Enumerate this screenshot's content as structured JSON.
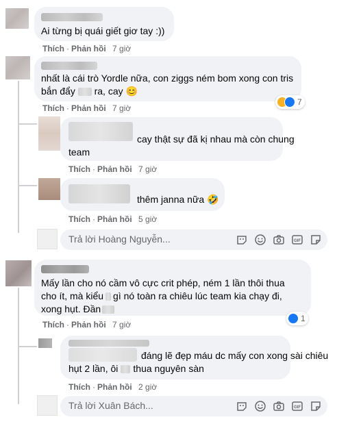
{
  "comments": [
    {
      "text": "Ai từng bị quái giết giơ tay :))",
      "like": "Thích",
      "reply": "Phản hồi",
      "time": "7 giờ"
    },
    {
      "text_line1": "nhất là cái trò Yordle nữa, con ziggs ném bom xong con tris",
      "text_line2_a": "bắn đẩy",
      "text_line2_b": "ra, cay 😊",
      "like": "Thích",
      "reply": "Phản hồi",
      "time": "7 giờ",
      "reaction_count": "7"
    },
    {
      "text_a": "cay thật sự đã kị nhau mà còn chung",
      "text_b": "team",
      "like": "Thích",
      "reply": "Phản hồi",
      "time": "7 giờ"
    },
    {
      "text": "thêm janna nữa 🤣",
      "like": "Thích",
      "reply": "Phản hồi",
      "time": "5 giờ"
    },
    {
      "placeholder": "Trả lời Hoàng Nguyễn..."
    },
    {
      "text_line1": "Mấy lần cho nó cầm vô cực crit phép, ném 1 lần thôi thua",
      "text_line2_a": "cho ít, mà kiểu",
      "text_line2_b": "gì nó toàn ra chiêu lúc team kia chạy đi,",
      "text_line3": "xong hụt. Đần",
      "like": "Thích",
      "reply": "Phản hồi",
      "time": "7 giờ",
      "reaction_count": "1"
    },
    {
      "text_line1": "đáng lẽ đẹp máu dc mấy con xong sài chiêu",
      "text_line2_a": "hụt 2 lần, ôi",
      "text_line2_b": "thua nguyên sàn",
      "like": "Thích",
      "reply": "Phản hồi",
      "time": "2 giờ"
    },
    {
      "placeholder": "Trả lời Xuân Bách..."
    }
  ],
  "icons": [
    "sticker-icon",
    "emoji-icon",
    "camera-icon",
    "gif-icon",
    "sticker-square-icon",
    "like-reaction-icon",
    "haha-reaction-icon"
  ],
  "colors": {
    "bubble": "#f0f2f5",
    "meta": "#65676b",
    "like_blue": "#1877f2",
    "haha": "#f7b125",
    "thread": "#ced0d4"
  }
}
